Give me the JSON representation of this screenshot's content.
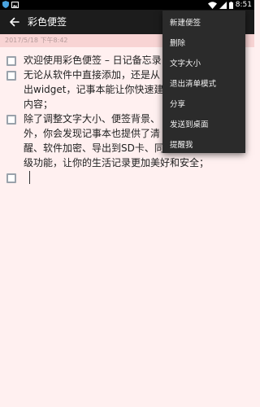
{
  "status_bar": {
    "time": "8:51",
    "left_icons": [
      "shield-icon",
      "image-icon"
    ],
    "right_icons": [
      "wifi-icon",
      "signal-icon",
      "battery-icon"
    ]
  },
  "app_bar": {
    "title": "彩色便签",
    "back_icon": "arrow-left-icon"
  },
  "note": {
    "date": "2017/5/18 下午8:42",
    "items": [
      {
        "text": "欢迎使用彩色便签 – 日记备忘录",
        "checked": false
      },
      {
        "text": "无论从软件中直接添加，还是从\n出widget，记事本能让你快速建\n内容；",
        "checked": false
      },
      {
        "text": "除了调整文字大小、便签背景、\n外，你会发现记事本也提供了清\n醒、软件加密、导出到SD卡、同\n级功能，让你的生活记录更加美好和安全；",
        "checked": false
      },
      {
        "text": "",
        "checked": false
      }
    ]
  },
  "menu": {
    "items": [
      "新建便签",
      "删除",
      "文字大小",
      "退出清单模式",
      "分享",
      "发送到桌面",
      "提醒我"
    ]
  },
  "colors": {
    "note_bg": "#fff0f0",
    "date_strip_bg": "#f8d4d4",
    "app_bar_bg": "#1c1c1c",
    "menu_bg": "#2b2b2b"
  }
}
